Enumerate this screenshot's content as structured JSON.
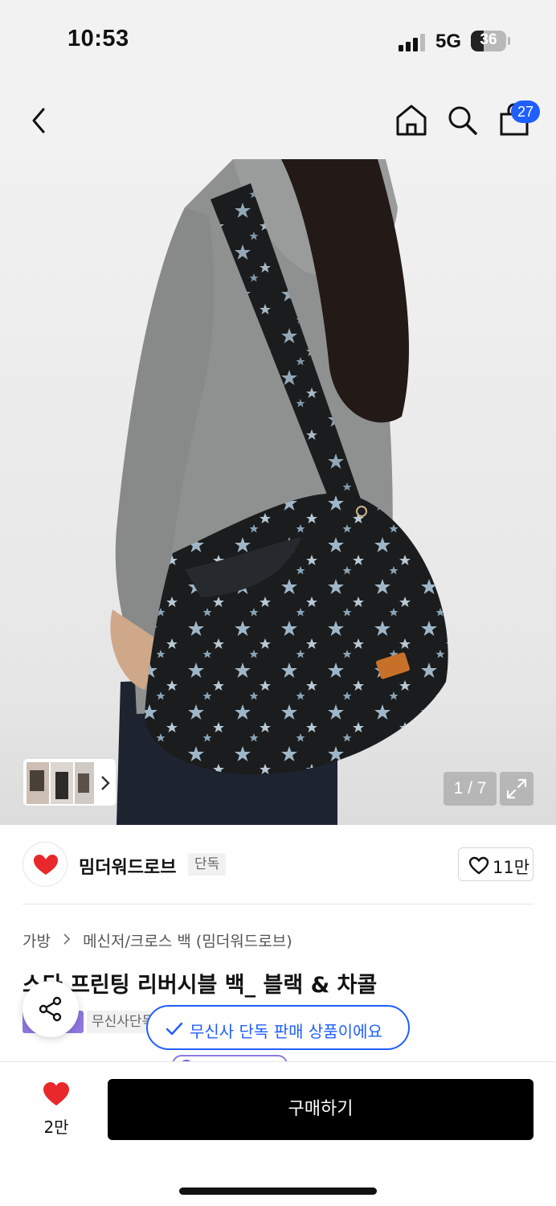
{
  "status_bar": {
    "time": "10:53",
    "network": "5G",
    "battery_level": "36",
    "battery_fraction": 0.36
  },
  "nav": {
    "icons": [
      "back-chevron-icon",
      "home-icon",
      "search-icon",
      "shopping-bag-icon"
    ],
    "cart_count": "27"
  },
  "gallery": {
    "page_indicator": "1 / 7",
    "thumbnail_icons": [
      "thumbnail-image",
      "chevron-right-icon"
    ],
    "expand_icon": "expand-icon"
  },
  "brand": {
    "name": "밈더워드로브",
    "tag": "단독",
    "likes": "11만",
    "logo_color": "#e8282b"
  },
  "product": {
    "breadcrumb": [
      "가방",
      "메신저/크로스 백 (밈더워드로브)"
    ],
    "title": "스타 프린팅 리버시블 백_ 블랙 & 차콜",
    "badge_text": "무신사단독"
  },
  "toast": {
    "text": "무신사 단독 판매 상품이에요"
  },
  "bottom_bar": {
    "favorite_count": "2만",
    "buy_label": "구매하기"
  },
  "colors": {
    "accent_blue": "#1f5eff",
    "heart_red": "#e8282b",
    "purple_badge": "#8f78e0"
  }
}
